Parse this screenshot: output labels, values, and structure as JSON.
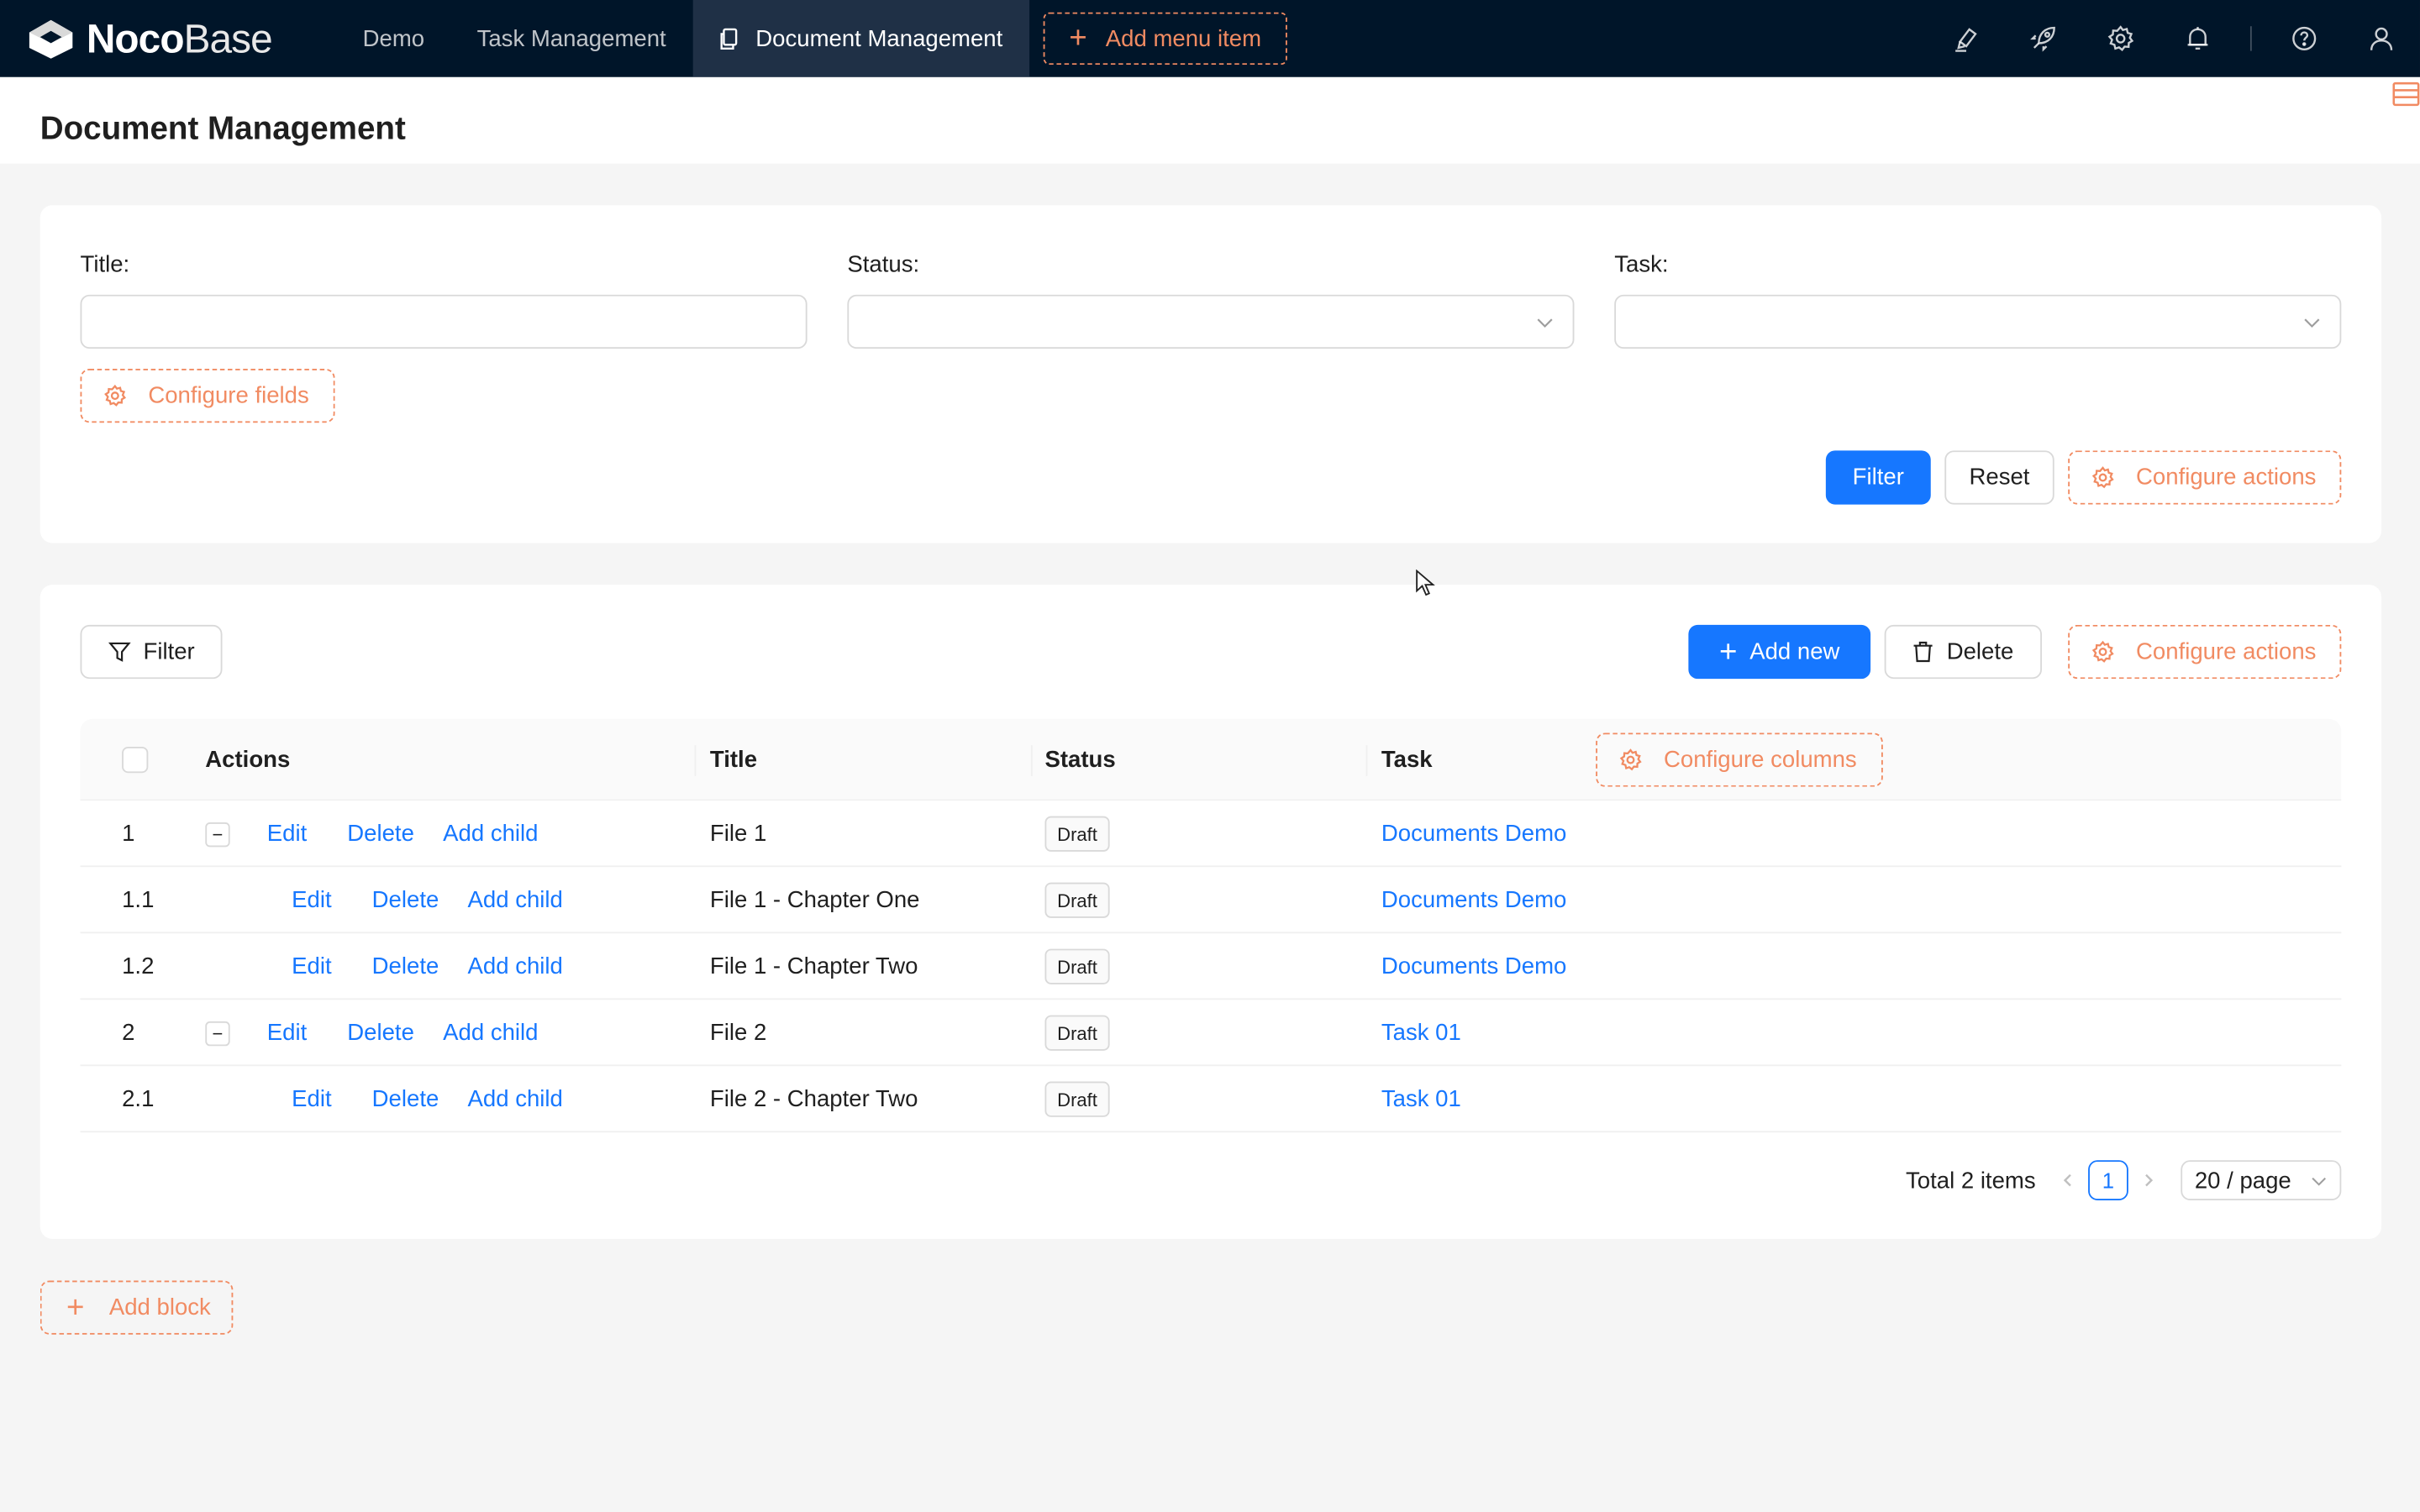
{
  "app": {
    "logo_noco": "Noco",
    "logo_base": "Base"
  },
  "nav": {
    "items": [
      {
        "label": "Demo"
      },
      {
        "label": "Task Management"
      },
      {
        "label": "Document Management",
        "active": true
      }
    ],
    "add_menu_label": "Add menu item",
    "right_icons": [
      "highlighter-icon",
      "rocket-icon",
      "gear-icon",
      "bell-icon",
      "help-icon",
      "user-icon"
    ]
  },
  "page": {
    "title": "Document Management"
  },
  "filter_form": {
    "fields": [
      {
        "label": "Title",
        "value": "",
        "type": "text"
      },
      {
        "label": "Status",
        "value": "",
        "type": "select"
      },
      {
        "label": "Task",
        "value": "",
        "type": "select"
      }
    ],
    "label_colon": ":",
    "configure_fields_label": "Configure fields",
    "filter_label": "Filter",
    "reset_label": "Reset",
    "configure_actions_label": "Configure actions"
  },
  "table_block": {
    "filter_label": "Filter",
    "add_new_label": "Add new",
    "delete_label": "Delete",
    "configure_actions_label": "Configure actions",
    "columns": [
      "Actions",
      "Title",
      "Status",
      "Task"
    ],
    "configure_columns_label": "Configure columns",
    "row_actions": {
      "edit": "Edit",
      "delete": "Delete",
      "add_child": "Add child"
    },
    "rows": [
      {
        "index": "1",
        "title": "File 1",
        "status": "Draft",
        "task": "Documents Demo",
        "expandable": true,
        "level": 0
      },
      {
        "index": "1.1",
        "title": "File 1 - Chapter One",
        "status": "Draft",
        "task": "Documents Demo",
        "expandable": false,
        "level": 1
      },
      {
        "index": "1.2",
        "title": "File 1 - Chapter Two",
        "status": "Draft",
        "task": "Documents Demo",
        "expandable": false,
        "level": 1
      },
      {
        "index": "2",
        "title": "File 2",
        "status": "Draft",
        "task": "Task 01",
        "expandable": true,
        "level": 0
      },
      {
        "index": "2.1",
        "title": "File 2 - Chapter Two",
        "status": "Draft",
        "task": "Task 01",
        "expandable": false,
        "level": 1
      }
    ],
    "pagination": {
      "total_text": "Total 2 items",
      "current_page": "1",
      "page_size": "20 / page"
    }
  },
  "add_block_label": "Add block",
  "colors": {
    "nav_bg": "#001529",
    "primary": "#1677ff",
    "config_orange": "#f18b62"
  }
}
